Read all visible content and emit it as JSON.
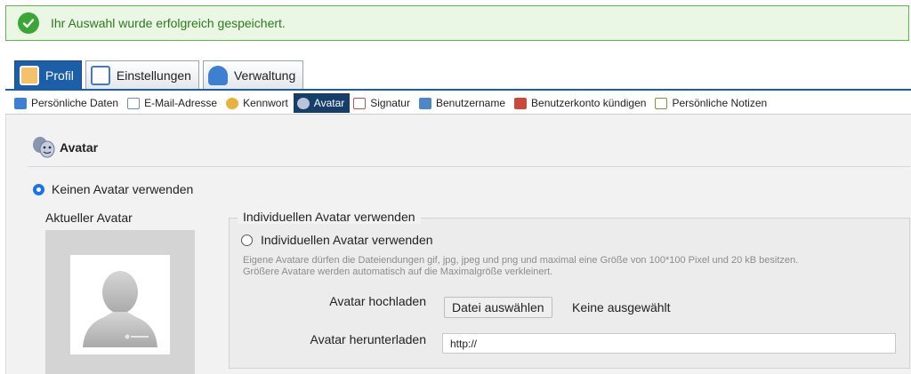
{
  "banner": {
    "message": "Ihr Auswahl wurde erfolgreich gespeichert."
  },
  "main_tabs": [
    {
      "label": "Profil",
      "active": true
    },
    {
      "label": "Einstellungen",
      "active": false
    },
    {
      "label": "Verwaltung",
      "active": false
    }
  ],
  "sub_nav": [
    {
      "label": "Persönliche Daten",
      "icon": "id-card-icon"
    },
    {
      "label": "E-Mail-Adresse",
      "icon": "email-icon"
    },
    {
      "label": "Kennwort",
      "icon": "keys-icon"
    },
    {
      "label": "Avatar",
      "icon": "masks-icon",
      "active": true
    },
    {
      "label": "Signatur",
      "icon": "pen-icon"
    },
    {
      "label": "Benutzername",
      "icon": "user-card-icon"
    },
    {
      "label": "Benutzerkonto kündigen",
      "icon": "delete-account-icon"
    },
    {
      "label": "Persönliche Notizen",
      "icon": "notes-icon"
    }
  ],
  "section": {
    "title": "Avatar"
  },
  "no_avatar_option": {
    "label": "Keinen Avatar verwenden",
    "selected": true
  },
  "current_avatar": {
    "label": "Aktueller Avatar"
  },
  "individual": {
    "legend": "Individuellen Avatar verwenden",
    "option_label": "Individuellen Avatar verwenden",
    "help_line1": "Eigene Avatare dürfen die Dateiendungen gif, jpg, jpeg und png und maximal eine Größe von 100*100 Pixel und 20 kB besitzen.",
    "help_line2": "Größere Avatare werden automatisch auf die Maximalgröße verkleinert.",
    "upload_label": "Avatar hochladen",
    "file_button": "Datei auswählen",
    "file_status": "Keine ausgewählt",
    "download_label": "Avatar herunterladen",
    "url_value": "http://"
  },
  "colors": {
    "accent": "#1d5ea8",
    "success": "#3aa635"
  }
}
